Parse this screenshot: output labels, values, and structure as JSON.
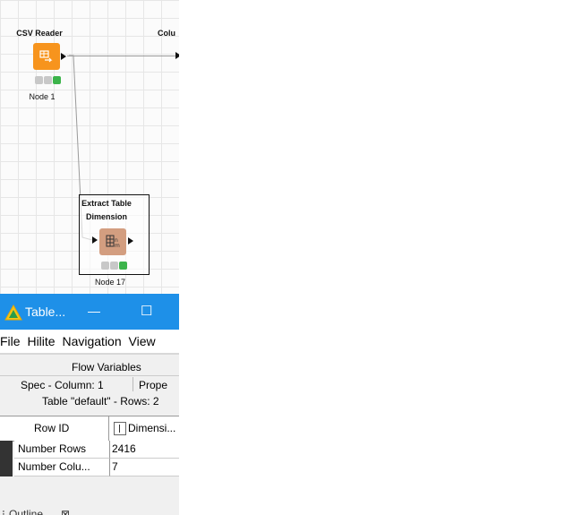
{
  "workflow": {
    "nodes": [
      {
        "title": "CSV Reader",
        "label": "Node 1",
        "color": "#f7941d"
      },
      {
        "title_line1": "Extract Table",
        "title_line2": "Dimension",
        "label": "Node 17",
        "color": "#d39e80"
      }
    ],
    "partial_node_title": "Colu"
  },
  "table_window": {
    "title": "Table...",
    "minimize": "—",
    "maximize": "☐",
    "menu": [
      "File",
      "Hilite",
      "Navigation",
      "View"
    ],
    "tabs_top": [
      "Flow Variables"
    ],
    "tabs_bottom": [
      "Spec - Column: 1",
      "Prope"
    ],
    "summary": "Table \"default\" - Rows: 2",
    "columns": [
      "Row ID",
      "Dimensi..."
    ],
    "rows": [
      {
        "id": "Number Rows",
        "value": "2416"
      },
      {
        "id": "Number Colu...",
        "value": "7"
      }
    ],
    "outline_tab": "Outline"
  },
  "colors": {
    "accent": "#1e90e8",
    "traffic_off": "#cccccc",
    "traffic_on": "#3cb44b"
  }
}
